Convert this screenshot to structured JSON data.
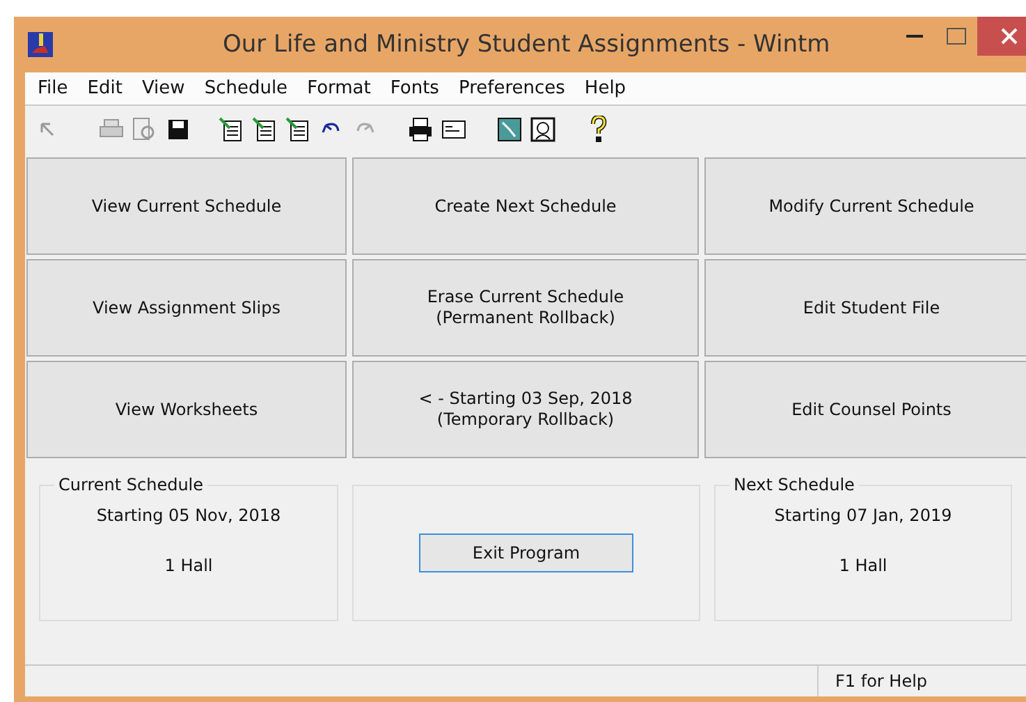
{
  "window": {
    "title": "Our Life and Ministry Student Assignments - Wintm"
  },
  "menu": [
    "File",
    "Edit",
    "View",
    "Schedule",
    "Format",
    "Fonts",
    "Preferences",
    "Help"
  ],
  "toolbar": [
    {
      "kind": "pointer",
      "disabled": true
    },
    {
      "kind": "print",
      "disabled": true
    },
    {
      "kind": "preview",
      "disabled": true
    },
    {
      "kind": "save",
      "disabled": false
    },
    {
      "kind": "sheet",
      "disabled": false
    },
    {
      "kind": "sheet",
      "disabled": false
    },
    {
      "kind": "sheet",
      "disabled": false
    },
    {
      "kind": "undo",
      "disabled": false
    },
    {
      "kind": "redo",
      "disabled": true
    },
    {
      "kind": "printer",
      "disabled": false
    },
    {
      "kind": "card",
      "disabled": false
    },
    {
      "kind": "map",
      "disabled": false
    },
    {
      "kind": "portrait",
      "disabled": false
    },
    {
      "kind": "help",
      "disabled": false
    }
  ],
  "buttons": [
    [
      "View Current Schedule"
    ],
    [
      "Create Next Schedule"
    ],
    [
      "Modify Current Schedule"
    ],
    [
      "View Assignment Slips"
    ],
    [
      "Erase Current Schedule",
      "(Permanent Rollback)"
    ],
    [
      "Edit Student File"
    ],
    [
      "View Worksheets"
    ],
    [
      "< - Starting 03 Sep, 2018",
      "(Temporary Rollback)"
    ],
    [
      "Edit Counsel Points"
    ]
  ],
  "current_schedule": {
    "title": "Current Schedule",
    "start": "Starting 05 Nov, 2018",
    "hall": "1 Hall"
  },
  "exit_button": "Exit Program",
  "next_schedule": {
    "title": "Next Schedule",
    "start": "Starting 07 Jan, 2019",
    "hall": "1 Hall"
  },
  "status_bar": {
    "help": "F1 for Help"
  }
}
